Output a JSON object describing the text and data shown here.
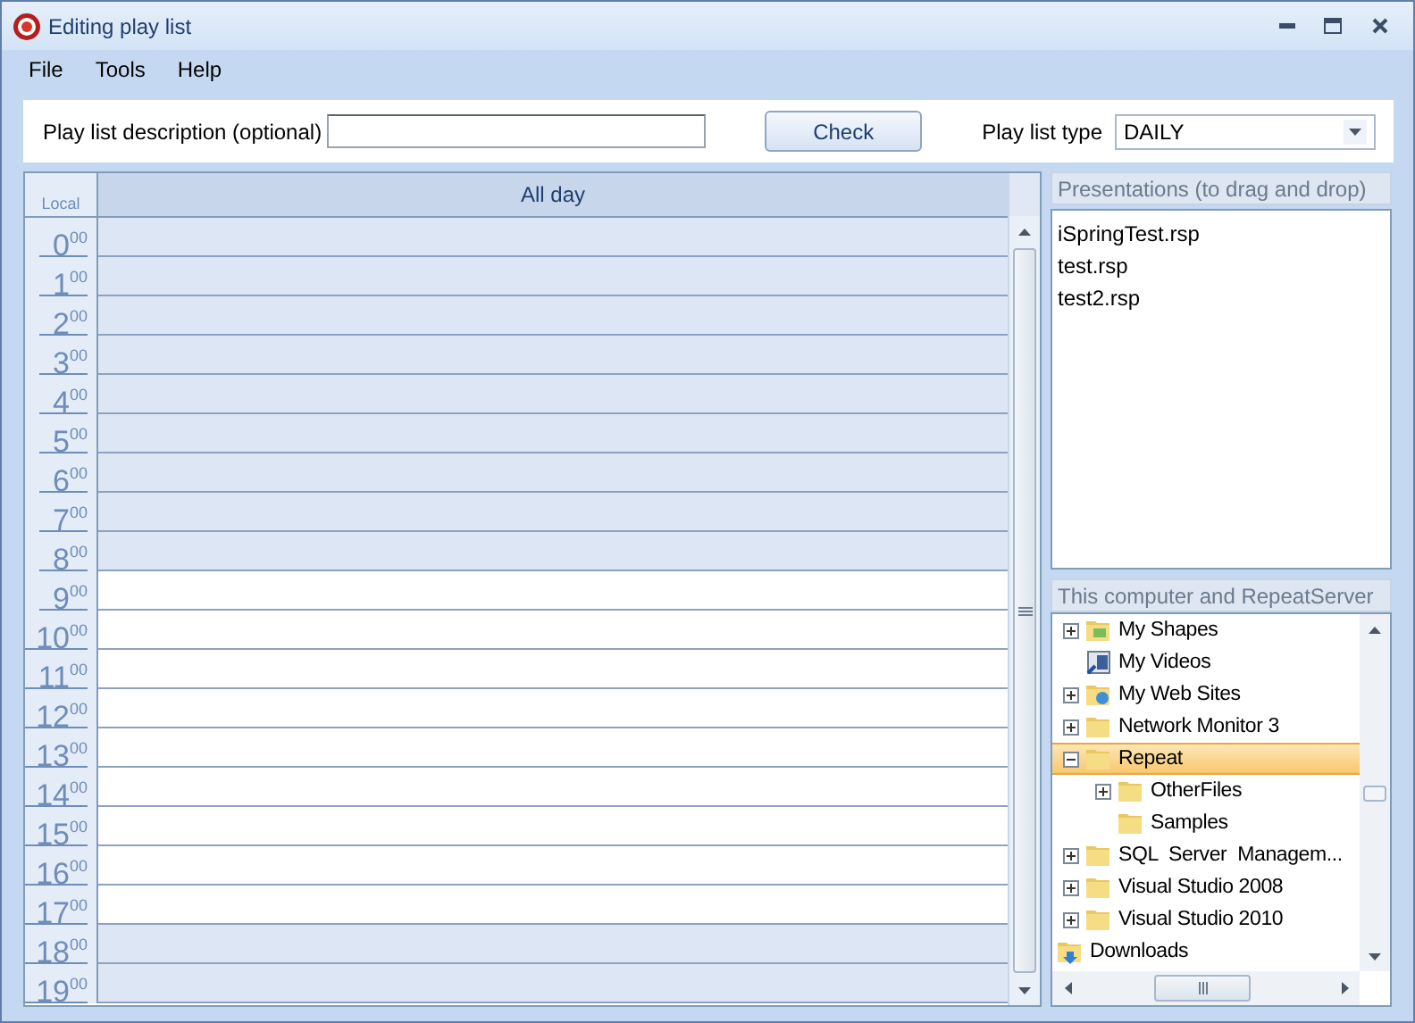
{
  "window": {
    "title": "Editing play list"
  },
  "menu": [
    "File",
    "Tools",
    "Help"
  ],
  "toolbar": {
    "description_label": "Play list description (optional)",
    "check_button": "Check",
    "type_label": "Play list type",
    "type_value": "DAILY"
  },
  "schedule": {
    "corner_label": "Local",
    "column": "All day",
    "hours": [
      {
        "hour": "0",
        "minutes": "00",
        "shaded": true
      },
      {
        "hour": "1",
        "minutes": "00",
        "shaded": true
      },
      {
        "hour": "2",
        "minutes": "00",
        "shaded": true
      },
      {
        "hour": "3",
        "minutes": "00",
        "shaded": true
      },
      {
        "hour": "4",
        "minutes": "00",
        "shaded": true
      },
      {
        "hour": "5",
        "minutes": "00",
        "shaded": true
      },
      {
        "hour": "6",
        "minutes": "00",
        "shaded": true
      },
      {
        "hour": "7",
        "minutes": "00",
        "shaded": true
      },
      {
        "hour": "8",
        "minutes": "00",
        "shaded": true
      },
      {
        "hour": "9",
        "minutes": "00",
        "shaded": false
      },
      {
        "hour": "10",
        "minutes": "00",
        "shaded": false
      },
      {
        "hour": "11",
        "minutes": "00",
        "shaded": false
      },
      {
        "hour": "12",
        "minutes": "00",
        "shaded": false
      },
      {
        "hour": "13",
        "minutes": "00",
        "shaded": false
      },
      {
        "hour": "14",
        "minutes": "00",
        "shaded": false
      },
      {
        "hour": "15",
        "minutes": "00",
        "shaded": false
      },
      {
        "hour": "16",
        "minutes": "00",
        "shaded": false
      },
      {
        "hour": "17",
        "minutes": "00",
        "shaded": false
      },
      {
        "hour": "18",
        "minutes": "00",
        "shaded": true
      },
      {
        "hour": "19",
        "minutes": "00",
        "shaded": true
      }
    ]
  },
  "presentations": {
    "title": "Presentations (to drag and drop)",
    "items": [
      "iSpringTest.rsp",
      "test.rsp",
      "test2.rsp"
    ]
  },
  "tree": {
    "title": "This computer and RepeatServer",
    "items": [
      {
        "children": [
          {
            "label": "My Shapes",
            "kind": "shapes",
            "expanded": false,
            "selected": false
          },
          {
            "label": "My Videos",
            "kind": "videos",
            "selected": false
          },
          {
            "label": "My Web Sites",
            "kind": "web",
            "expanded": false,
            "selected": false
          },
          {
            "label": "Network Monitor 3",
            "kind": "folder",
            "expanded": false,
            "selected": false
          },
          {
            "label": "Repeat",
            "kind": "folder",
            "expanded": true,
            "selected": true,
            "children": [
              {
                "label": "OtherFiles",
                "kind": "folder",
                "expanded": false,
                "selected": false
              },
              {
                "label": "Samples",
                "kind": "folder",
                "selected": false
              }
            ]
          },
          {
            "label": "SQL  Server  Managem...",
            "kind": "folder",
            "expanded": false,
            "selected": false
          },
          {
            "label": "Visual Studio 2008",
            "kind": "folder",
            "expanded": false,
            "selected": false
          },
          {
            "label": "Visual Studio 2010",
            "kind": "folder",
            "expanded": false,
            "selected": false
          }
        ]
      },
      {
        "label": "Downloads",
        "kind": "downloads",
        "selected": false
      }
    ]
  }
}
